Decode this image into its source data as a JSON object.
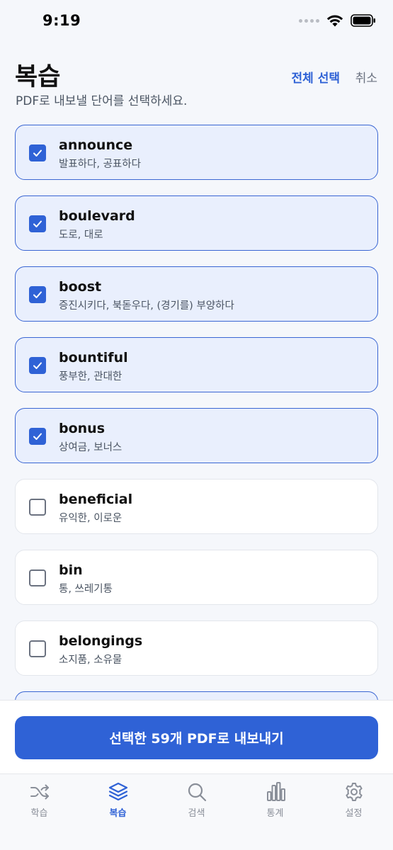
{
  "status_bar": {
    "time": "9:19",
    "icons": [
      "signal-dots-icon",
      "wifi-icon",
      "battery-icon"
    ]
  },
  "header": {
    "title": "복습",
    "subtitle": "PDF로 내보낼 단어를 선택하세요.",
    "select_all": "전체 선택",
    "cancel": "취소"
  },
  "colors": {
    "accent": "#2f62d6",
    "selected_bg": "#e9effd",
    "selected_border": "#3a66d3",
    "background": "#f5f7fb"
  },
  "words": [
    {
      "word": "announce",
      "meaning": "발표하다, 공표하다",
      "checked": true
    },
    {
      "word": "boulevard",
      "meaning": "도로, 대로",
      "checked": true
    },
    {
      "word": "boost",
      "meaning": "증진시키다, 북돋우다, (경기를) 부양하다",
      "checked": true
    },
    {
      "word": "bountiful",
      "meaning": "풍부한, 관대한",
      "checked": true
    },
    {
      "word": "bonus",
      "meaning": "상여금, 보너스",
      "checked": true
    },
    {
      "word": "beneficial",
      "meaning": "유익한, 이로운",
      "checked": false
    },
    {
      "word": "bin",
      "meaning": "통, 쓰레기통",
      "checked": false
    },
    {
      "word": "belongings",
      "meaning": "소지품, 소유물",
      "checked": false
    },
    {
      "word": "",
      "meaning": "",
      "checked": true
    }
  ],
  "export_button": "선택한 59개 PDF로 내보내기",
  "tabs": [
    {
      "label": "학습",
      "icon": "shuffle-icon",
      "active": false
    },
    {
      "label": "복습",
      "icon": "layers-icon",
      "active": true
    },
    {
      "label": "검색",
      "icon": "search-icon",
      "active": false
    },
    {
      "label": "통계",
      "icon": "bar-chart-icon",
      "active": false
    },
    {
      "label": "설정",
      "icon": "gear-icon",
      "active": false
    }
  ]
}
